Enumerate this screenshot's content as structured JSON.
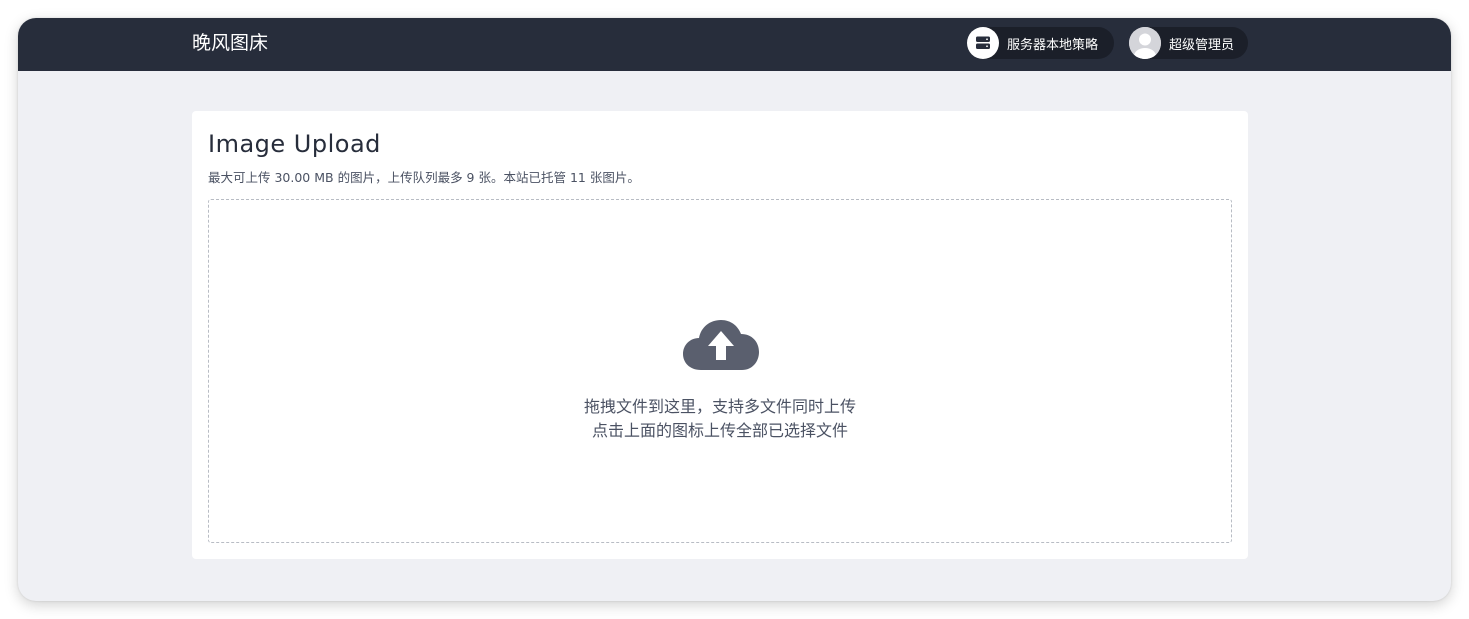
{
  "header": {
    "brand": "晚风图床",
    "strategy_label": "服务器本地策略",
    "user_label": "超级管理员",
    "strategy_icon": "server-icon",
    "user_icon": "avatar-icon"
  },
  "upload": {
    "title": "Image Upload",
    "subtitle": "最大可上传 30.00 MB 的图片，上传队列最多 9 张。本站已托管 11 张图片。",
    "drop_line1": "拖拽文件到这里，支持多文件同时上传",
    "drop_line2": "点击上面的图标上传全部已选择文件",
    "icon": "cloud-upload-icon"
  },
  "colors": {
    "navbar": "#272d3b",
    "page_background": "#eff0f4",
    "card": "#ffffff",
    "text_muted": "#4b5263",
    "icon": "#5a5f6e"
  }
}
